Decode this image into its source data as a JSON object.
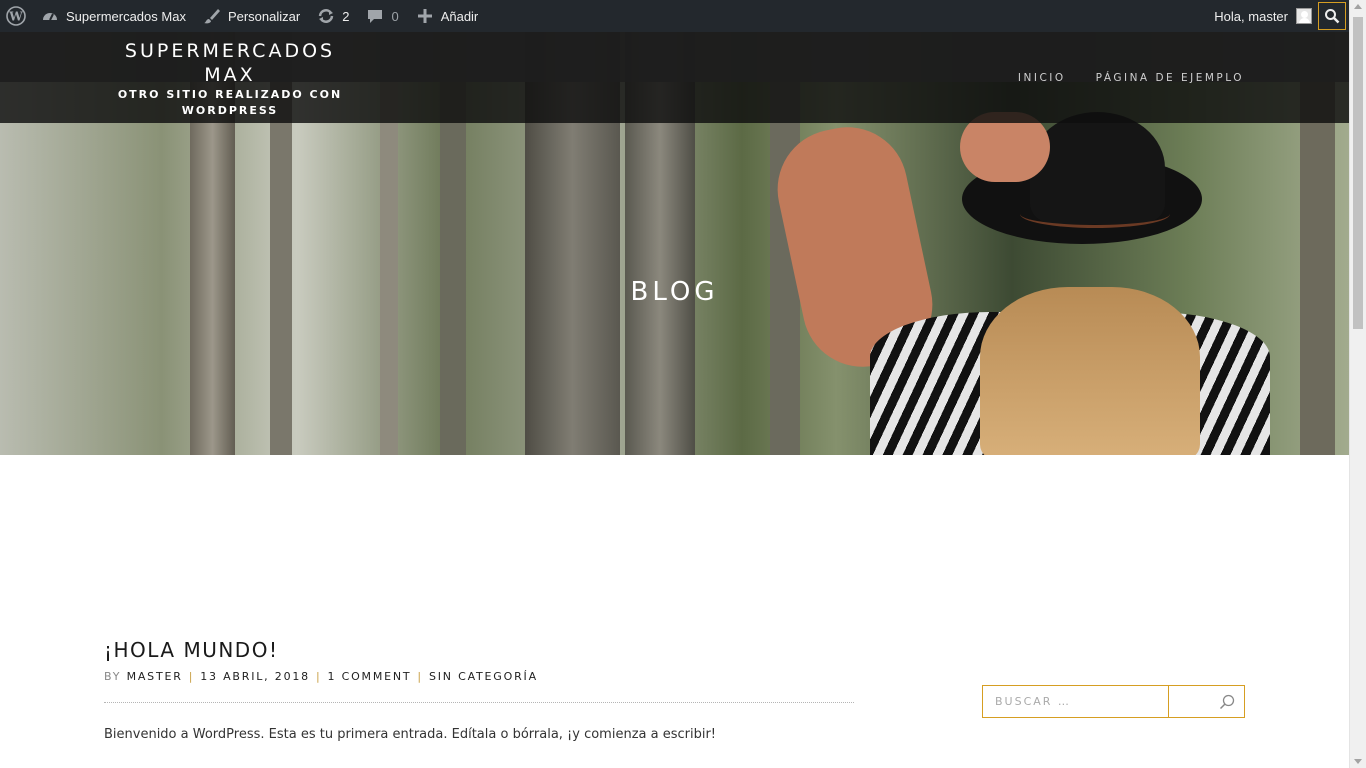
{
  "admin_bar": {
    "site_name": "Supermercados Max",
    "customize": "Personalizar",
    "updates_count": "2",
    "comments_count": "0",
    "add_new": "Añadir",
    "greeting": "Hola, master"
  },
  "header": {
    "site_title": "SUPERMERCADOS MAX",
    "site_description": "OTRO SITIO REALIZADO CON WORDPRESS",
    "nav": [
      "INICIO",
      "PÁGINA DE EJEMPLO"
    ]
  },
  "hero": {
    "title": "BLOG"
  },
  "post": {
    "title": "¡HOLA MUNDO!",
    "by": "BY",
    "author": "MASTER",
    "date": "13 ABRIL, 2018",
    "comments": "1 COMMENT",
    "category": "SIN CATEGORÍA",
    "excerpt": "Bienvenido a WordPress. Esta es tu primera entrada. Edítala o bórrala, ¡y comienza a escribir!"
  },
  "sidebar": {
    "search_placeholder": "BUSCAR …"
  },
  "colors": {
    "accent": "#d69e22",
    "admin_bar": "#23282d"
  }
}
